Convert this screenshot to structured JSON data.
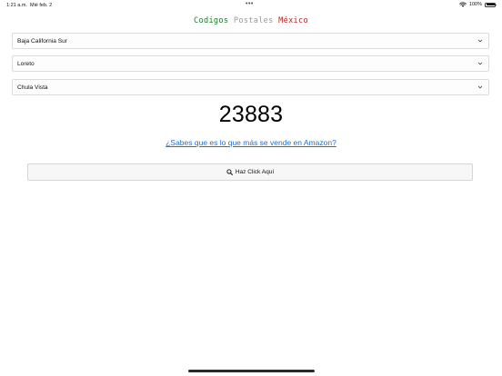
{
  "status_bar": {
    "time": "1:21 a.m.",
    "date": "Mié feb. 2",
    "battery": "100%",
    "battery_level": 1.0,
    "wifi_icon": "wifi-icon",
    "multitask_dots": "•••"
  },
  "header": {
    "title_word1": "Codigos",
    "title_word2": "Postales",
    "title_word3": "México"
  },
  "selects": {
    "state": {
      "value": "Baja California Sur",
      "icon": "chevron-down-icon"
    },
    "municipality": {
      "value": "Loreto",
      "icon": "chevron-down-icon"
    },
    "settlement": {
      "value": "Chula Vista",
      "icon": "chevron-down-icon"
    }
  },
  "result": {
    "postal_code": "23883"
  },
  "amazon_link": {
    "label": "¿Sabes que es lo que más se vende en Amazon?"
  },
  "action_button": {
    "label": "Haz Click Aquí",
    "icon": "search-icon"
  },
  "colors": {
    "title_green": "#1a7a2a",
    "title_gray": "#9a9a9a",
    "title_red": "#c0201f",
    "link_blue": "#1f6fe0"
  }
}
